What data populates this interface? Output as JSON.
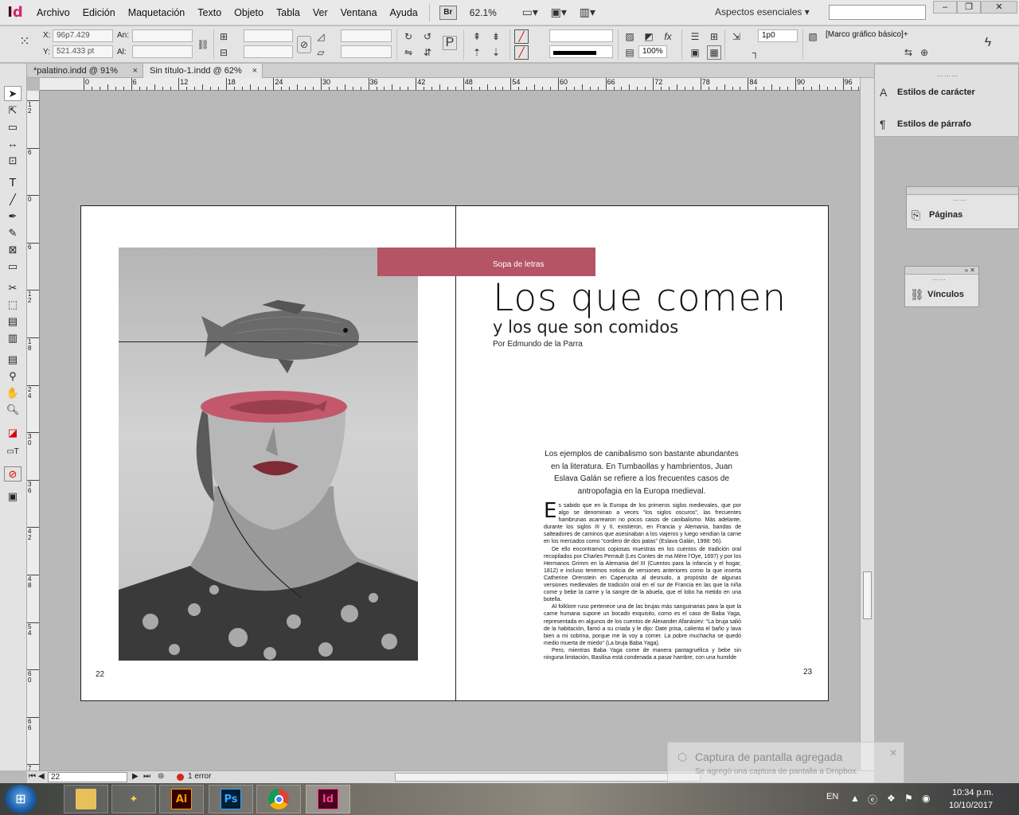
{
  "menubar": {
    "logo_main": "I",
    "logo_accent": "d",
    "items": [
      "Archivo",
      "Edición",
      "Maquetación",
      "Texto",
      "Objeto",
      "Tabla",
      "Ver",
      "Ventana",
      "Ayuda"
    ],
    "bridge_label": "Br",
    "zoom": "62.1%",
    "workspace": "Aspectos esenciales"
  },
  "control": {
    "x_label": "X:",
    "x_value": "96p7.429",
    "y_label": "Y:",
    "y_value": "521.433 pt",
    "w_label": "An:",
    "h_label": "Al:",
    "stroke_weight": "1p0",
    "scale": "100%",
    "object_style": "[Marco gráfico básico]+"
  },
  "tabs": [
    {
      "label": "*palatino.indd @ 91%",
      "close": "×"
    },
    {
      "label": "Sin título-1.indd @ 62%",
      "close": "×"
    }
  ],
  "ruler": {
    "top_labels": [
      "0",
      "6",
      "12",
      "18",
      "24",
      "30",
      "36",
      "42",
      "48",
      "54",
      "60",
      "66",
      "72",
      "78",
      "84",
      "90",
      "96"
    ],
    "left_labels": [
      "12",
      "6",
      "0",
      "6",
      "12",
      "18",
      "24",
      "30",
      "36",
      "42",
      "48",
      "54",
      "60",
      "66",
      "72"
    ]
  },
  "page": {
    "band_label": "Sopa de letras",
    "title": "Los  que  comen",
    "subtitle": "y los que son comidos",
    "byline": "Por Edmundo de la Parra",
    "lead": "Los ejemplos de canibalismo son bastante abundantes en la literatura. En Tumbaollas y hambrientos, Juan Eslava Galán se refiere a los frecuentes casos de antropofagia en la Europa medieval.",
    "dropcap": "E",
    "body": [
      "s sabido que en la Europa de los primeros siglos medievales, que por algo se denominan a veces “los siglos oscuros”, las frecuentes hambrunas acarrearon no pocos casos de canibalismo. Más adelante, durante los siglos III y II, existieron, en Francia y Alemania, bandas de salteadores de caminos que asesinaban a los viajeros y luego vendían la carne en los mercados como “cordero de dos patas” (Eslava Galán, 1998: 56).",
      "De ello encontramos copiosas muestras en los cuentos de tradición oral recopilados por Charles Perrault (Les Contes de ma Mère l'Oye, 1697) y por los Hermanos Grimm en la Alemania del III (Cuentos para la infancia y el hogar, 1812) e incluso tenemos noticia de versiones anteriores como la que inserta Catherine Orenstein en Caperucita al desnudo, a propósito de algunas versiones medievales de tradición oral en el sur de Francia en las que la niña come y bebe la carne y la sangre de la abuela, que el lobo ha metido en una botella.",
      "Al folklore ruso pertenece una de las brujas más sanguinarias para la que la carne humana supone un bocado exquisito, como es el caso de Baba Yaga, representada en algunos de los cuentos de Alexander Afanásiev: “La bruja salió de la habitación, llamó a su criada y le dijo: Date prisa, calienta el baño y lava bien a mi sobrina, porque me la voy a comer. La pobre muchacha se quedó medio muerta de miedo” (La bruja Baba Yaga).",
      "Pero, mientras Baba Yaga come de manera pantagruélica y bebe sin ninguna limitación, Basilisa está condenada a pasar hambre, con una humilde"
    ],
    "page_left": "22",
    "page_right": "23"
  },
  "panels": {
    "char_styles": "Estilos de carácter",
    "para_styles": "Estilos de párrafo",
    "pages": "Páginas",
    "links": "Vínculos"
  },
  "status": {
    "page": "22",
    "errors": "1 error"
  },
  "toast": {
    "title": "Captura de pantalla agregada",
    "body": "Se agregó una captura de pantalla a Dropbox."
  },
  "taskbar": {
    "lang": "EN",
    "time": "10:34 p.m.",
    "date": "10/10/2017",
    "apps": [
      "Ai",
      "Ps",
      "Id"
    ]
  },
  "colors": {
    "accent_band": "#b55465",
    "indesign": "#49021f",
    "illustrator_bg": "#330000",
    "illustrator_fg": "#ff9a00",
    "photoshop_bg": "#001e36",
    "photoshop_fg": "#31a8ff"
  },
  "icons": [
    "selection-tool-icon",
    "direct-selection-icon",
    "type-tool-icon",
    "pen-tool-icon",
    "rectangle-frame-icon",
    "hand-tool-icon",
    "zoom-tool-icon",
    "search-icon",
    "fish-illustration",
    "chrome-icon",
    "folder-icon"
  ]
}
